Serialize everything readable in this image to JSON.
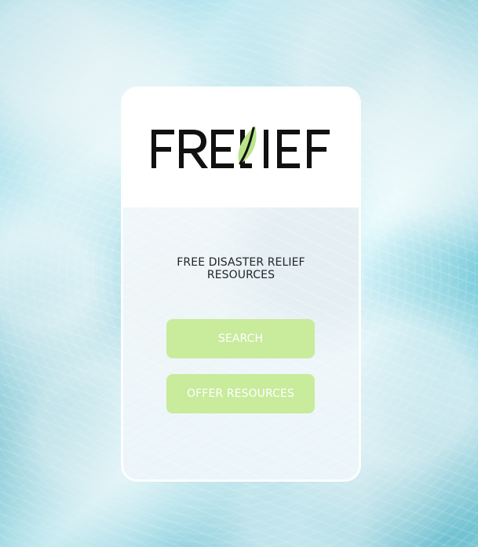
{
  "brand": {
    "logo_text": "FRELIEF",
    "leaf_color": "#b8e58a",
    "wordmark_color": "#111111"
  },
  "hero": {
    "headline": "FREE DISASTER RELIEF\nRESOURCES"
  },
  "actions": {
    "search_label": "SEARCH",
    "offer_resources_label": "OFFER RESOURCES",
    "button_color": "#c8eb9c",
    "button_text_color": "#ffffff"
  },
  "icons": {
    "logo_leaf": "leaf-icon"
  }
}
